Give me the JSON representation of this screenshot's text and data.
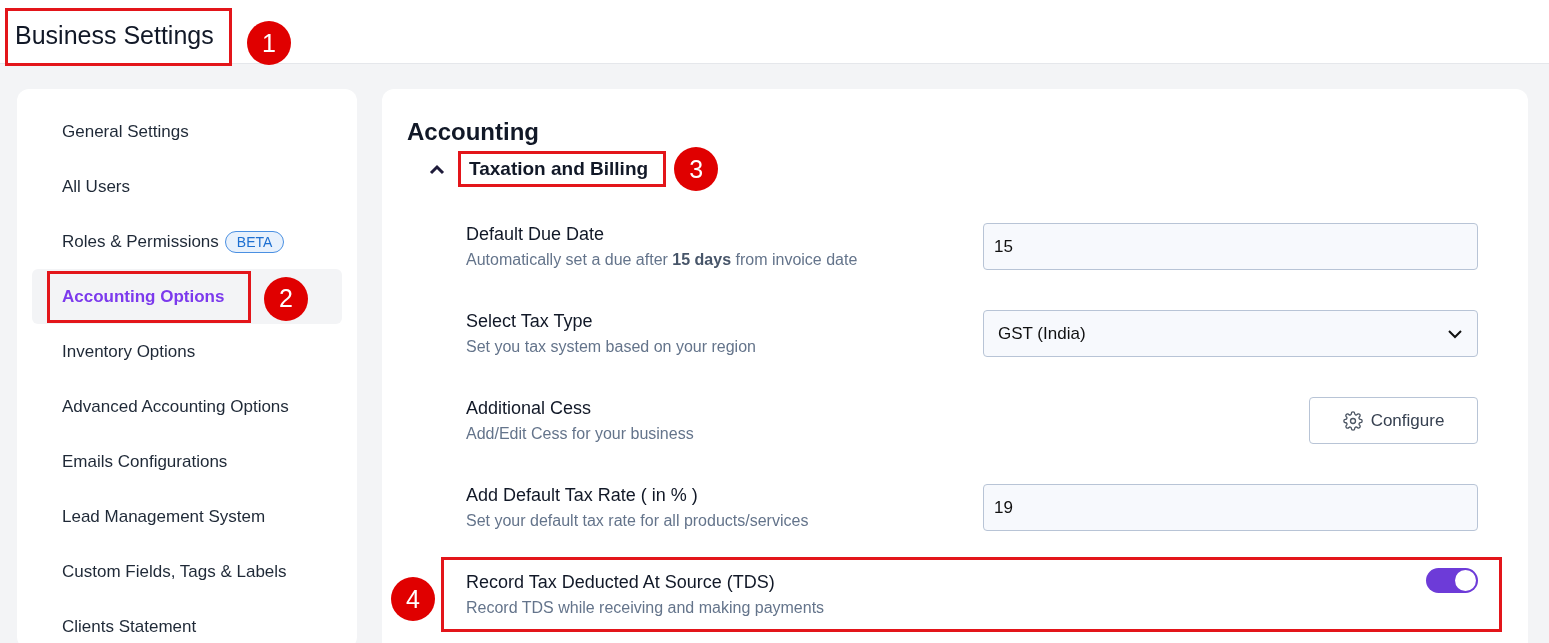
{
  "header": {
    "title": "Business Settings",
    "callout": "1"
  },
  "sidebar": {
    "items": [
      {
        "label": "General Settings",
        "selected": false
      },
      {
        "label": "All Users",
        "selected": false
      },
      {
        "label": "Roles & Permissions",
        "selected": false,
        "badge": "BETA"
      },
      {
        "label": "Accounting Options",
        "selected": true,
        "callout": "2"
      },
      {
        "label": "Inventory Options",
        "selected": false
      },
      {
        "label": "Advanced Accounting Options",
        "selected": false
      },
      {
        "label": "Emails Configurations",
        "selected": false
      },
      {
        "label": "Lead Management System",
        "selected": false
      },
      {
        "label": "Custom Fields, Tags & Labels",
        "selected": false
      },
      {
        "label": "Clients Statement",
        "selected": false
      }
    ]
  },
  "content": {
    "title": "Accounting",
    "section": {
      "title": "Taxation and Billing",
      "expanded": true,
      "callout": "3",
      "settings": [
        {
          "kind": "input",
          "label": "Default Due Date",
          "description": "Automatically set a due after **15 days** from invoice date",
          "value": "15"
        },
        {
          "kind": "select",
          "label": "Select Tax Type",
          "description": "Set you tax system based on your region",
          "value": "GST (India)"
        },
        {
          "kind": "button",
          "label": "Additional Cess",
          "description": "Add/Edit Cess for your business",
          "button": "Configure"
        },
        {
          "kind": "input",
          "label": "Add Default Tax Rate ( in % )",
          "description": "Set your default tax rate for all products/services",
          "value": "19"
        },
        {
          "kind": "toggle",
          "label": "Record Tax Deducted At Source (TDS)",
          "description": "Record TDS while receiving and making payments",
          "on": true,
          "callout": "4"
        }
      ]
    }
  }
}
